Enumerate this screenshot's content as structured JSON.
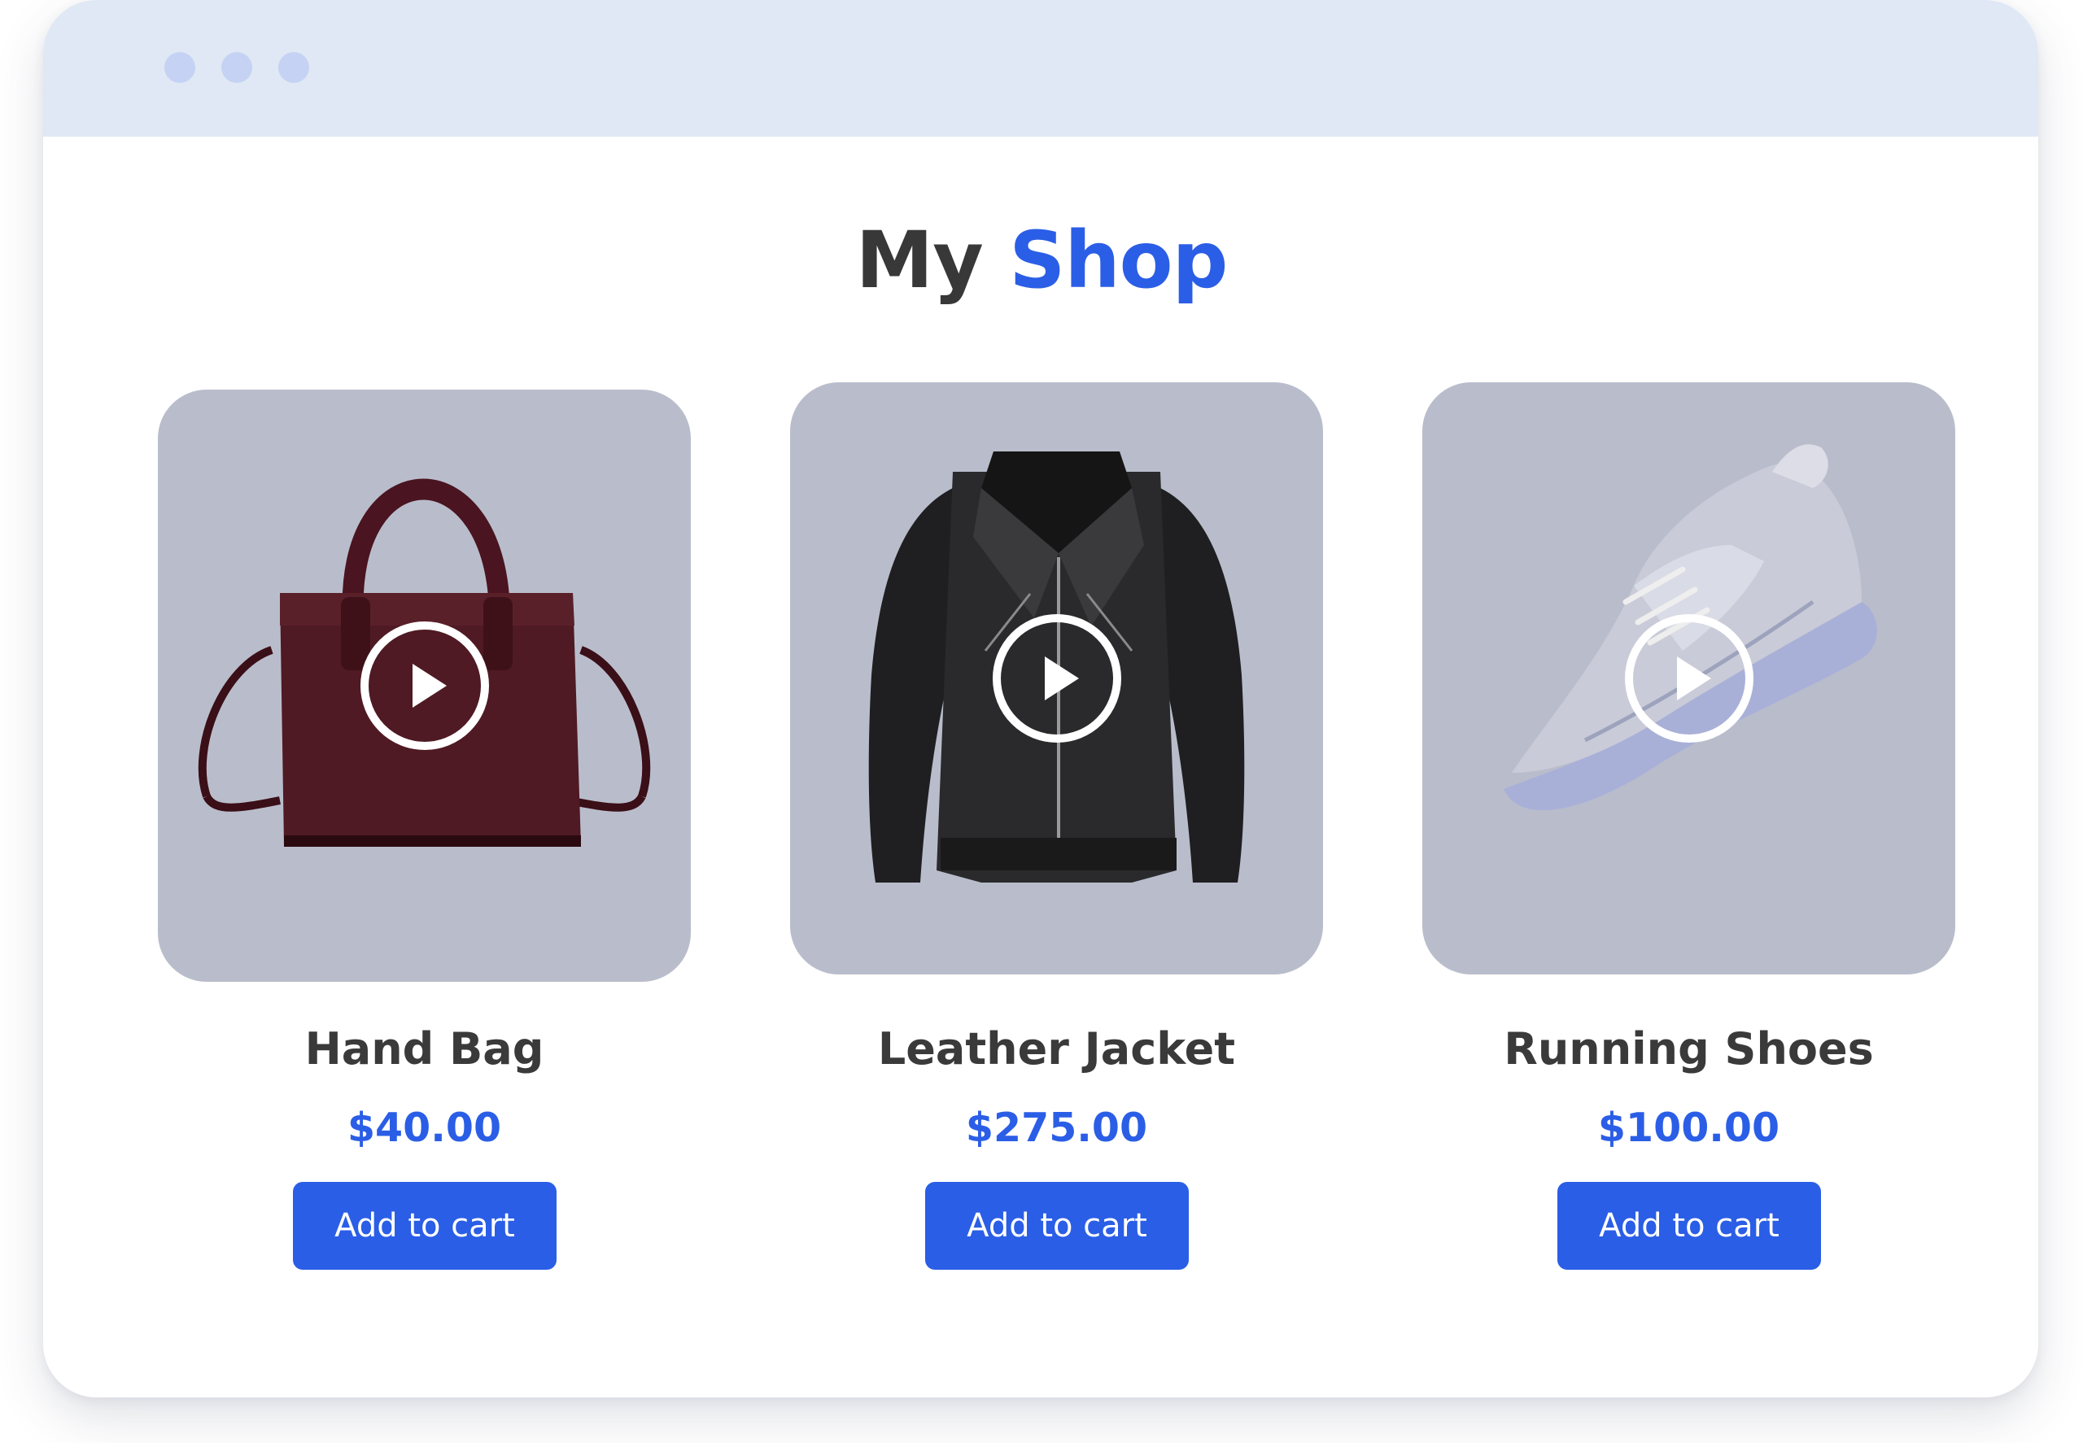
{
  "colors": {
    "accent": "#2b5ee6",
    "title_text": "#383838",
    "titlebar": "#dfe8f4",
    "card_bg": "#b9bdcb"
  },
  "header": {
    "title_part1": "My",
    "title_part2": "Shop"
  },
  "products": [
    {
      "name": "Hand Bag",
      "price": "$40.00",
      "cta": "Add to cart",
      "image_icon": "handbag-image"
    },
    {
      "name": "Leather Jacket",
      "price": "$275.00",
      "cta": "Add to cart",
      "image_icon": "jacket-image"
    },
    {
      "name": "Running Shoes",
      "price": "$100.00",
      "cta": "Add to cart",
      "image_icon": "sneaker-image"
    }
  ],
  "icons": {
    "play": "play-icon",
    "window_dots": [
      "window-dot-icon",
      "window-dot-icon",
      "window-dot-icon"
    ]
  }
}
